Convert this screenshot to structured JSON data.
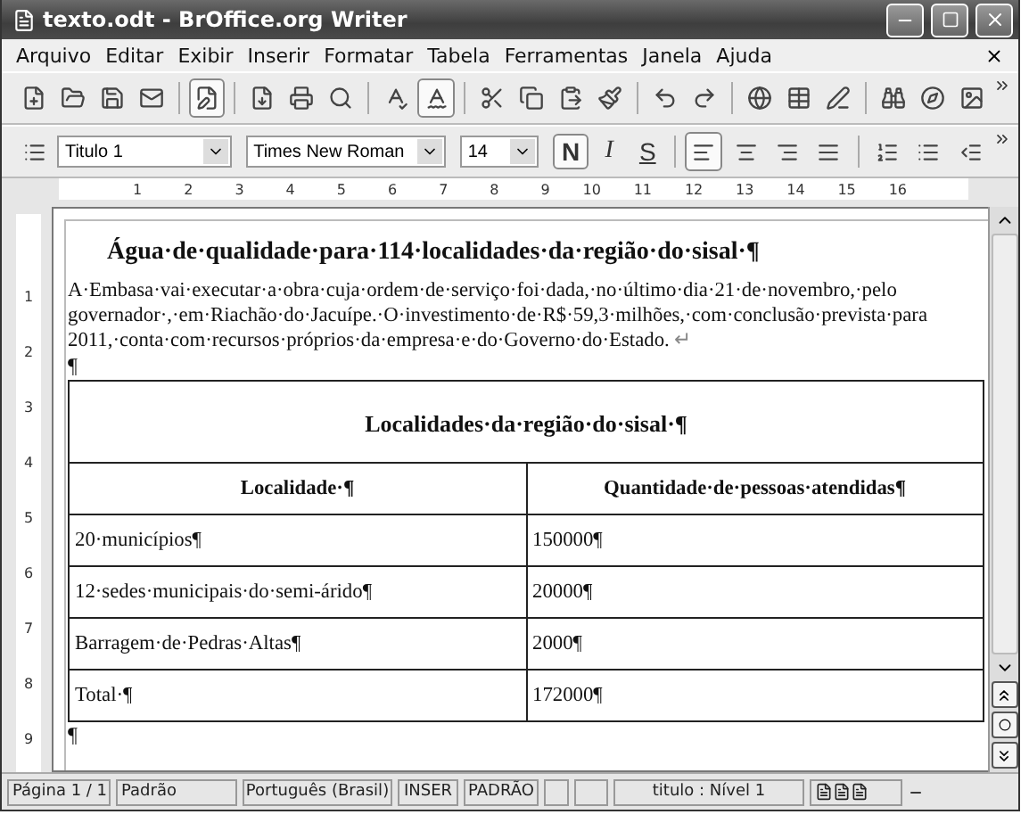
{
  "window": {
    "title": "texto.odt - BrOffice.org Writer"
  },
  "menu": [
    "Arquivo",
    "Editar",
    "Exibir",
    "Inserir",
    "Formatar",
    "Tabela",
    "Ferramentas",
    "Janela",
    "Ajuda"
  ],
  "standard_toolbar": [
    {
      "kind": "new",
      "pressed": false
    },
    {
      "kind": "open",
      "pressed": false
    },
    {
      "kind": "save",
      "pressed": false
    },
    {
      "kind": "mail",
      "pressed": false
    },
    {
      "kind": "sep"
    },
    {
      "kind": "edit",
      "pressed": true
    },
    {
      "kind": "sep"
    },
    {
      "kind": "pdf",
      "pressed": false
    },
    {
      "kind": "print",
      "pressed": false
    },
    {
      "kind": "preview",
      "pressed": false
    },
    {
      "kind": "sep"
    },
    {
      "kind": "spell",
      "pressed": false
    },
    {
      "kind": "autospell",
      "pressed": true
    },
    {
      "kind": "sep"
    },
    {
      "kind": "cut",
      "pressed": false
    },
    {
      "kind": "copy",
      "pressed": false
    },
    {
      "kind": "paste",
      "pressed": false
    },
    {
      "kind": "brush",
      "pressed": false
    },
    {
      "kind": "sep"
    },
    {
      "kind": "undo",
      "pressed": false
    },
    {
      "kind": "redo",
      "pressed": false
    },
    {
      "kind": "sep"
    },
    {
      "kind": "globe",
      "pressed": false
    },
    {
      "kind": "table",
      "pressed": false
    },
    {
      "kind": "draw",
      "pressed": false
    },
    {
      "kind": "sep"
    },
    {
      "kind": "find",
      "pressed": false
    },
    {
      "kind": "navigator",
      "pressed": false
    },
    {
      "kind": "gallery",
      "pressed": false
    }
  ],
  "format_toolbar": {
    "style": "Titulo 1",
    "font": "Times New Roman",
    "size": "14",
    "text_buttons": [
      {
        "label": "N",
        "kind": "bold",
        "selected": true
      },
      {
        "label": "I",
        "kind": "italic",
        "selected": false
      },
      {
        "label": "S",
        "kind": "underline",
        "selected": false
      }
    ],
    "align_buttons": [
      {
        "kind": "left",
        "selected": true
      },
      {
        "kind": "center",
        "selected": false
      },
      {
        "kind": "right",
        "selected": false
      },
      {
        "kind": "justify",
        "selected": false
      }
    ],
    "list_buttons": [
      {
        "kind": "numbered"
      },
      {
        "kind": "bullets"
      },
      {
        "kind": "outdent"
      }
    ]
  },
  "ruler": {
    "marks": [
      "1",
      "2",
      "3",
      "4",
      "5",
      "6",
      "7",
      "8",
      "9",
      "10",
      "11",
      "12",
      "13",
      "14",
      "15",
      "16"
    ],
    "vertical_marks": [
      "1",
      "2",
      "3",
      "4",
      "5",
      "6",
      "7",
      "8",
      "9"
    ]
  },
  "document": {
    "heading": "Água·de·qualidade·para·114·localidades·da·região·do·sisal·¶",
    "paragraph": "A·Embasa·vai·executar·a·obra·cuja·ordem·de·serviço·foi·dada,·no·último·dia·21·de·novembro,·pelo governador·,·em·Riachão·do·Jacuípe.·O·investimento·de·R$·59,3·milhões,·com·conclusão·prevista·para 2011,·conta·com·recursos·próprios·da·empresa·e·do·Governo·do·Estado.",
    "line_break_mark": "↵",
    "empty_paragraph": "¶",
    "table": {
      "title": "Localidades·da·região·do·sisal·¶",
      "columns": [
        "Localidade·¶",
        "Quantidade·de·pessoas·atendidas¶"
      ],
      "rows": [
        [
          "20·municípios¶",
          "150000¶"
        ],
        [
          "12·sedes·municipais·do·semi-árido¶",
          "20000¶"
        ],
        [
          "Barragem·de·Pedras·Altas¶",
          "2000¶"
        ],
        [
          "Total·¶",
          "172000¶"
        ]
      ]
    },
    "trailing_paragraph": "¶"
  },
  "status_bar": [
    "Página 1 / 1",
    "Padrão",
    "Português (Brasil)",
    "INSER",
    "PADRÃO",
    "titulo : Nível 1"
  ]
}
